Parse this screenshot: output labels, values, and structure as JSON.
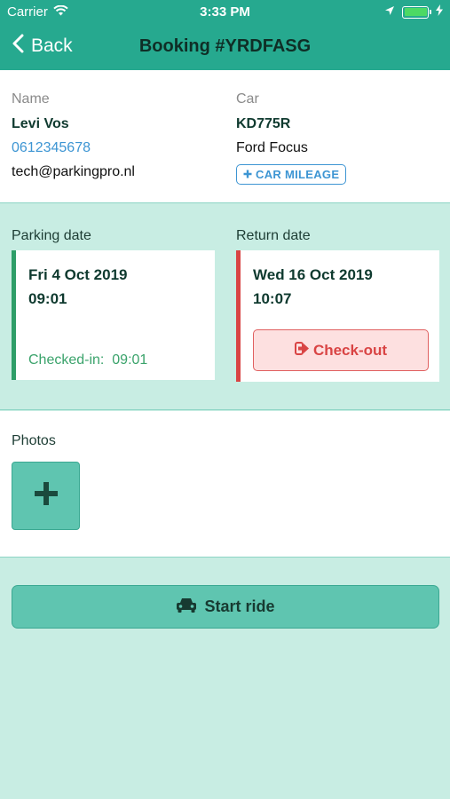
{
  "status_bar": {
    "carrier": "Carrier",
    "time": "3:33 PM"
  },
  "nav": {
    "back_label": "Back",
    "title": "Booking #YRDFASG"
  },
  "customer": {
    "name_label": "Name",
    "name": "Levi Vos",
    "phone": "0612345678",
    "email": "tech@parkingpro.nl"
  },
  "car": {
    "label": "Car",
    "plate": "KD775R",
    "model": "Ford Focus",
    "mileage_button": "CAR MILEAGE"
  },
  "parking": {
    "label": "Parking date",
    "date": "Fri 4 Oct 2019",
    "time": "09:01",
    "checked_in_label": "Checked-in:",
    "checked_in_time": "09:01"
  },
  "return": {
    "label": "Return date",
    "date": "Wed 16 Oct 2019",
    "time": "10:07",
    "checkout_button": "Check-out"
  },
  "photos": {
    "label": "Photos"
  },
  "actions": {
    "start_ride": "Start ride"
  },
  "colors": {
    "header": "#26a98f",
    "background": "#c8ede3",
    "checked_in_accent": "#2e9e68",
    "return_accent": "#d94444",
    "link": "#3d95d3"
  }
}
